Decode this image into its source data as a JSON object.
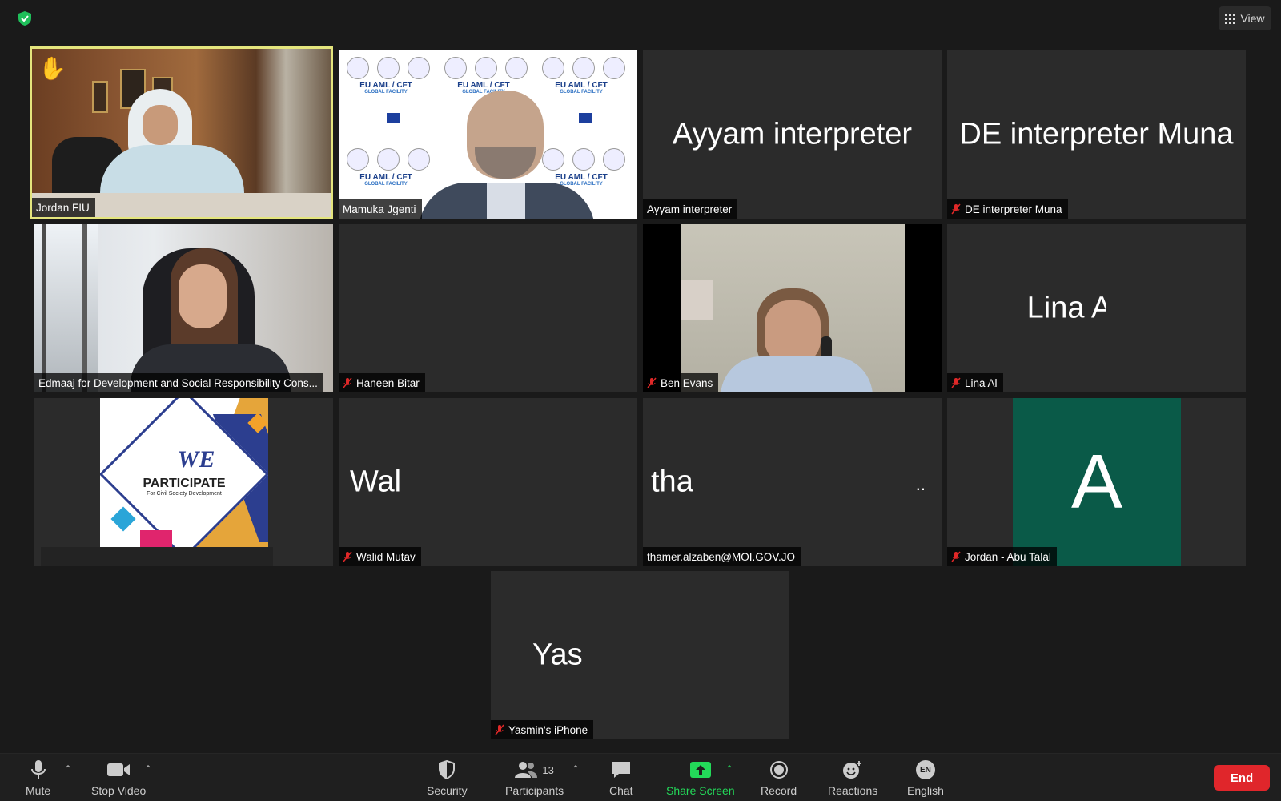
{
  "topbar": {
    "view_label": "View"
  },
  "tiles": {
    "jordan_fiu": {
      "name": "Jordan FIU",
      "hand": "✋"
    },
    "mamuka": {
      "name": "Mamuka Jgenti",
      "banner_title": "EU AML / CFT",
      "banner_sub": "GLOBAL FACILITY"
    },
    "ayyam": {
      "big": "Ayyam interpreter",
      "name": "Ayyam interpreter"
    },
    "de_muna": {
      "big": "DE interpreter Muna",
      "name": "DE interpreter Muna"
    },
    "edmaaj": {
      "name": "Edmaaj for Development and Social Responsibility Cons..."
    },
    "haneen": {
      "name": "Haneen Bitar"
    },
    "ben": {
      "name": "Ben Evans"
    },
    "lina": {
      "big": "Lina A",
      "name": "Lina Al"
    },
    "weparticipate": {
      "logo_word": "WE",
      "logo_title": "PARTICIPATE",
      "logo_sub": "For Civil Society Development"
    },
    "walid": {
      "big": "Wal",
      "name": "Walid Mutav"
    },
    "thamer": {
      "big": "tha",
      "dots": "..",
      "name": "thamer.alzaben@MOI.GOV.JO"
    },
    "abu_talal": {
      "avatar_letter": "A",
      "name": "Jordan - Abu Talal"
    },
    "yasmin": {
      "big": "Yas",
      "name": "Yasmin's iPhone"
    }
  },
  "toolbar": {
    "mute": "Mute",
    "stop_video": "Stop Video",
    "security": "Security",
    "participants": "Participants",
    "participants_count": "13",
    "chat": "Chat",
    "share_screen": "Share Screen",
    "record": "Record",
    "reactions": "Reactions",
    "language_badge": "EN",
    "language": "English",
    "end": "End"
  },
  "colors": {
    "active_speaker": "#e4e57d",
    "share_green": "#23d959",
    "end_red": "#e0262b",
    "avatar_bg": "#0a5a48",
    "mute_red": "#e02828"
  }
}
